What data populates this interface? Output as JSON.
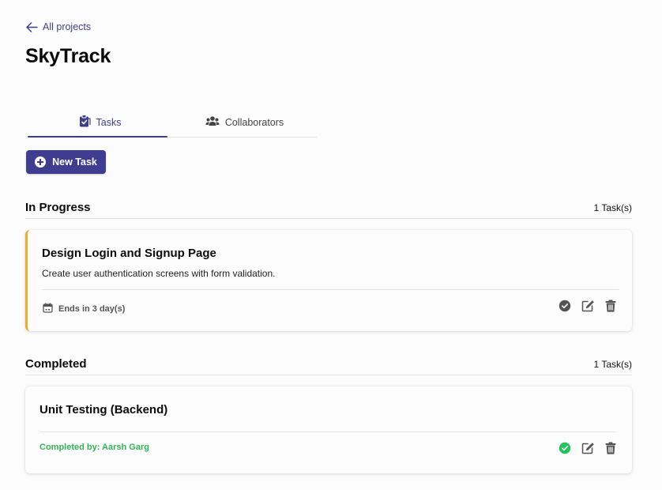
{
  "nav": {
    "back_label": "All projects",
    "back_icon": "arrow-left-icon"
  },
  "project": {
    "title": "SkyTrack"
  },
  "tabs": [
    {
      "label": "Tasks",
      "icon": "clipboard-icon",
      "active": true
    },
    {
      "label": "Collaborators",
      "icon": "users-icon",
      "active": false
    }
  ],
  "toolbar": {
    "new_task_label": "New Task",
    "new_task_icon": "plus-circle-icon"
  },
  "sections": [
    {
      "title": "In Progress",
      "count_label": "1 Task(s)",
      "tasks": [
        {
          "title": "Design Login and Signup Page",
          "description": "Create user authentication screens with form validation.",
          "due_label": "Ends in 3 day(s)",
          "due_icon": "calendar-icon",
          "status_color": "#e3b12a"
        }
      ]
    },
    {
      "title": "Completed",
      "count_label": "1 Task(s)",
      "tasks": [
        {
          "title": "Unit Testing (Backend)",
          "completed_by_label": "Completed by: Aarsh Garg",
          "status_color": "#2fb457"
        }
      ]
    }
  ],
  "colors": {
    "accent": "#3f3d8f",
    "in_progress": "#e3b12a",
    "completed": "#22c35a",
    "pending_check": "#555555"
  }
}
